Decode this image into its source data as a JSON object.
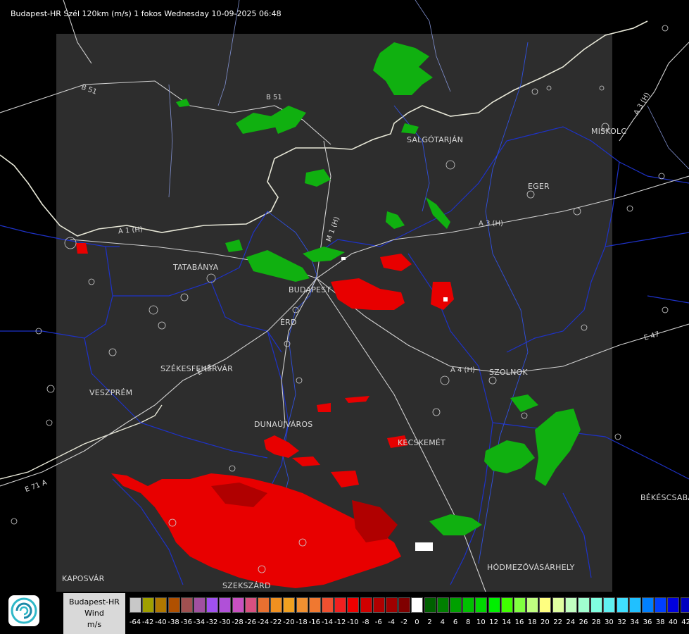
{
  "title": "Budapest-HR Szél 120km (m/s) 1 fokos Wednesday 10-09-2025 06:48",
  "cities": [
    {
      "name": "SALGÓTARJÁN"
    },
    {
      "name": "MISKOLC"
    },
    {
      "name": "EGER"
    },
    {
      "name": "TATABÁNYA"
    },
    {
      "name": "BUDAPEST"
    },
    {
      "name": "ÉRD"
    },
    {
      "name": "SZÉKESFEHÉRVÁR"
    },
    {
      "name": "VESZPRÉM"
    },
    {
      "name": "DUNAÚJVÁROS"
    },
    {
      "name": "KECSKEMÉT"
    },
    {
      "name": "SZOLNOK"
    },
    {
      "name": "BÉKÉSCSABA"
    },
    {
      "name": "HÓDMEZŐVÁSÁRHELY"
    },
    {
      "name": "KAPOSVÁR"
    },
    {
      "name": "SZEKSZÁRD"
    }
  ],
  "roads": [
    "B 51",
    "B 51",
    "A 1 (H)",
    "M 1 (H)",
    "A 3 (H)",
    "A 3 (H)",
    "E 71",
    "A 4 (H)",
    "E 47",
    "E 71 A"
  ],
  "legend": {
    "line1": "Budapest-HR",
    "line2": "Wind",
    "line3": "m/s",
    "ticks": [
      "-64",
      "-42",
      "-40",
      "-38",
      "-36",
      "-34",
      "-32",
      "-30",
      "-28",
      "-26",
      "-24",
      "-22",
      "-20",
      "-18",
      "-16",
      "-14",
      "-12",
      "-10",
      "-8",
      "-6",
      "-4",
      "-2",
      "0",
      "2",
      "4",
      "6",
      "8",
      "10",
      "12",
      "14",
      "16",
      "18",
      "20",
      "22",
      "24",
      "26",
      "28",
      "30",
      "32",
      "34",
      "36",
      "38",
      "40",
      "42"
    ],
    "colors": [
      "#c8c8c8",
      "#a0a000",
      "#b07800",
      "#b05000",
      "#a05050",
      "#a050a0",
      "#a050f0",
      "#b050d8",
      "#c850c0",
      "#d85080",
      "#e87030",
      "#f09020",
      "#f0a020",
      "#f09030",
      "#f07830",
      "#f05030",
      "#f02020",
      "#f00000",
      "#d00000",
      "#b00000",
      "#a00000",
      "#800000",
      "#ffffff",
      "#006000",
      "#008000",
      "#00a000",
      "#00c000",
      "#00d800",
      "#00f000",
      "#40ff00",
      "#80ff40",
      "#c0ff80",
      "#ffff80",
      "#e0ffa0",
      "#c0ffc0",
      "#a0ffd0",
      "#80ffe0",
      "#60f0f0",
      "#40e0ff",
      "#20c0ff",
      "#0080ff",
      "#0040ff",
      "#0000e0",
      "#0000c0"
    ]
  },
  "icons": {
    "logo": "omsz-swirl-icon"
  }
}
